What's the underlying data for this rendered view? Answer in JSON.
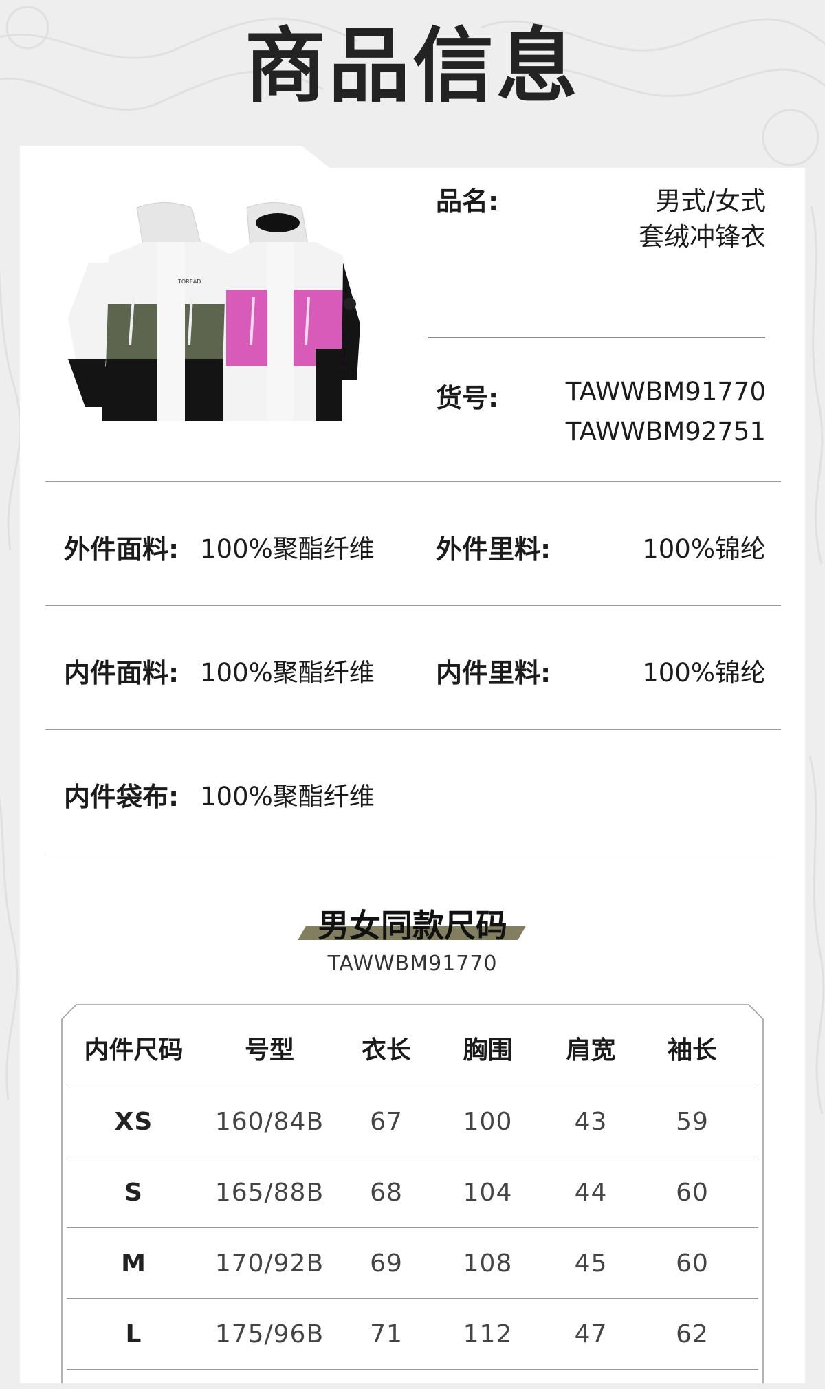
{
  "header": {
    "title": "商品信息"
  },
  "product": {
    "name_label": "品名:",
    "name_value_line1": "男式/女式",
    "name_value_line2": "套绒冲锋衣",
    "sku_label": "货号:",
    "sku_value_line1": "TAWWBM91770",
    "sku_value_line2": "TAWWBM92751",
    "image_brand_text": "TOREAD"
  },
  "materials": [
    {
      "label": "外件面料:",
      "value": "100%聚酯纤维"
    },
    {
      "label": "外件里料:",
      "value": "100%锦纶"
    },
    {
      "label": "内件面料:",
      "value": "100%聚酯纤维"
    },
    {
      "label": "内件里料:",
      "value": "100%锦纶"
    },
    {
      "label": "内件袋布:",
      "value": "100%聚酯纤维"
    }
  ],
  "size_section": {
    "title": "男女同款尺码",
    "code": "TAWWBM91770",
    "accent_color": "#817f60",
    "columns": [
      "内件尺码",
      "号型",
      "衣长",
      "胸围",
      "肩宽",
      "袖长"
    ],
    "rows": [
      [
        "XS",
        "160/84B",
        "67",
        "100",
        "43",
        "59"
      ],
      [
        "S",
        "165/88B",
        "68",
        "104",
        "44",
        "60"
      ],
      [
        "M",
        "170/92B",
        "69",
        "108",
        "45",
        "60"
      ],
      [
        "L",
        "175/96B",
        "71",
        "112",
        "47",
        "62"
      ]
    ]
  }
}
